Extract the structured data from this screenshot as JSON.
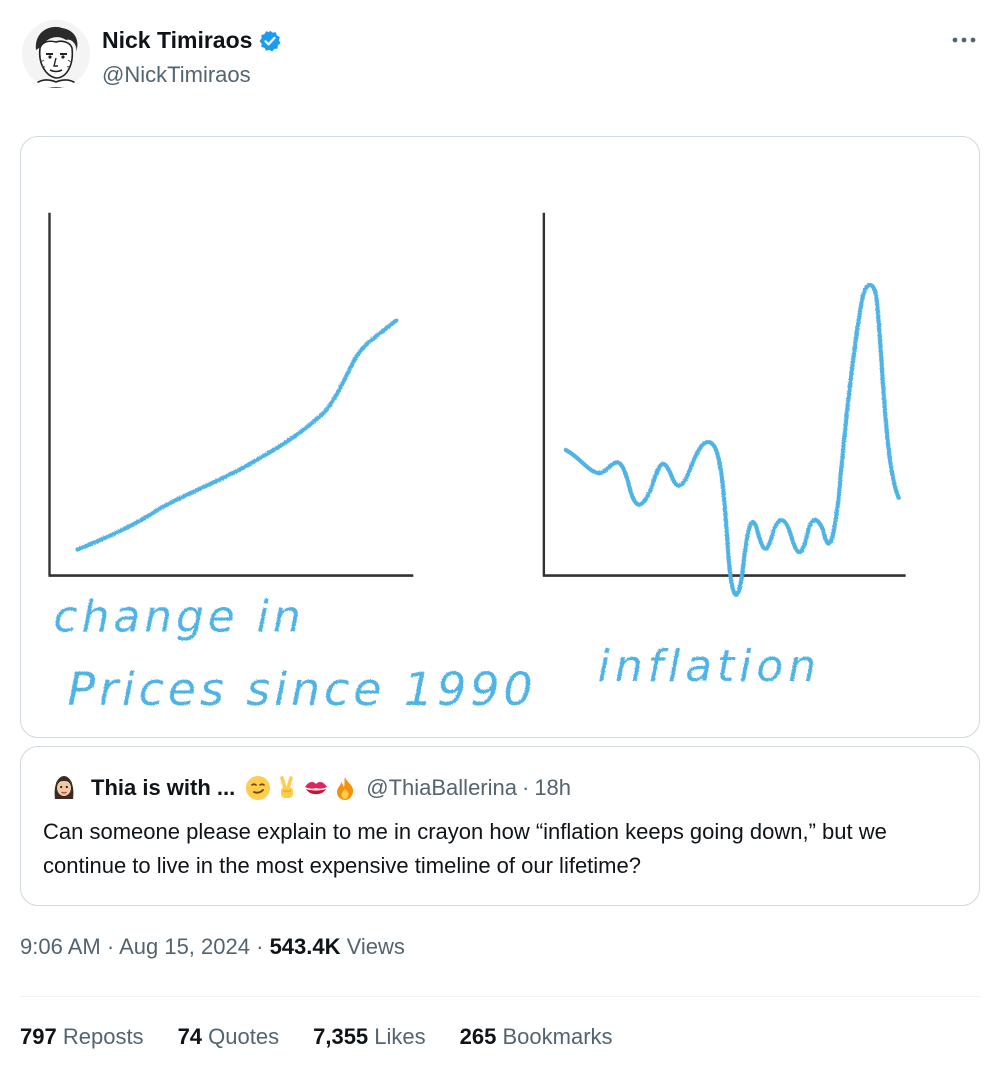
{
  "author": {
    "name": "Nick Timiraos",
    "handle": "@NickTimiraos",
    "verified_color": "#1d9bf0"
  },
  "media": {
    "left_caption_line1": "change in",
    "left_caption_line2": "Prices since 1990",
    "right_caption": "inflation",
    "crayon_color": "#4fb3e6"
  },
  "quote": {
    "name": "Thia is with ...",
    "emojis": [
      "smirking-face",
      "victory-hand",
      "kiss-mark",
      "fire"
    ],
    "handle": "@ThiaBallerina",
    "separator": "·",
    "time": "18h",
    "text": "Can someone please explain to me in crayon how “inflation keeps going down,” but we continue to live in the most expensive timeline of our lifetime?"
  },
  "meta": {
    "time": "9:06 AM",
    "separator": "·",
    "date": "Aug 15, 2024",
    "views_count": "543.4K",
    "views_label": "Views"
  },
  "stats": [
    {
      "count": "797",
      "label": "Reposts"
    },
    {
      "count": "74",
      "label": "Quotes"
    },
    {
      "count": "7,355",
      "label": "Likes"
    },
    {
      "count": "265",
      "label": "Bookmarks"
    }
  ]
}
